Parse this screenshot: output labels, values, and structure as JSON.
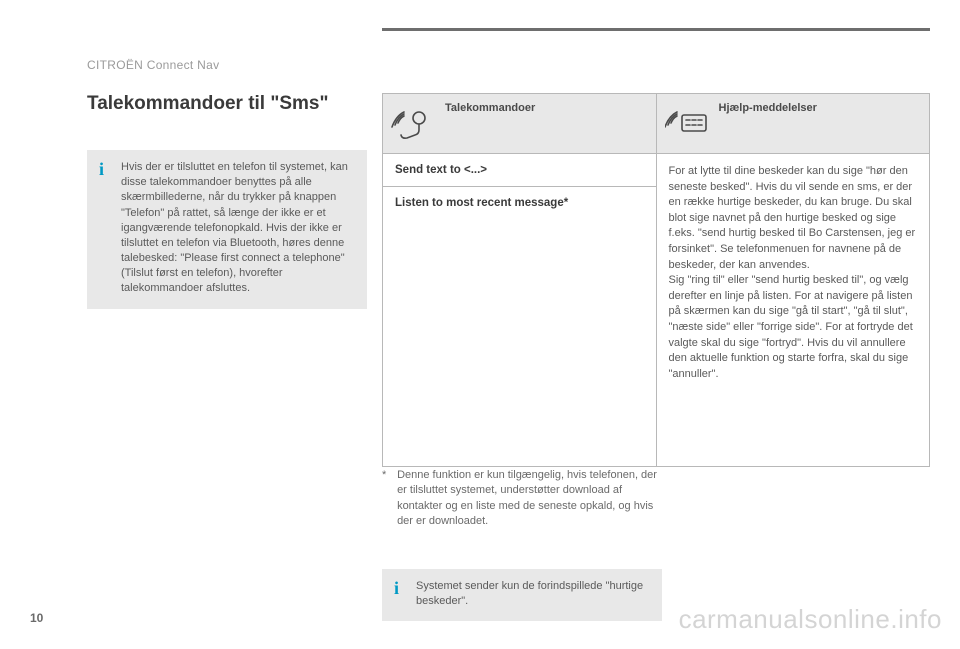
{
  "header": {
    "section": "CITROËN Connect Nav"
  },
  "page": {
    "number": "10",
    "title": "Talekommandoer til \"Sms\""
  },
  "info1": {
    "text": "Hvis der er tilsluttet en telefon til systemet, kan disse talekommandoer benyttes på alle skærmbillederne, når du trykker på knappen \"Telefon\" på rattet, så længe der ikke er et igangværende telefonopkald. Hvis der ikke er tilsluttet en telefon via Bluetooth, høres denne talebesked: \"Please first connect a telephone\" (Tilslut først en telefon), hvorefter talekommandoer afsluttes."
  },
  "table": {
    "col1_header": "Talekommandoer",
    "col2_header": "Hjælp-meddelelser",
    "row1_cmd": "Send text to <...>",
    "row2_cmd": "Listen to most recent message*",
    "help_text": "For at lytte til dine beskeder kan du sige \"hør den seneste besked\". Hvis du vil sende en sms, er der en række hurtige beskeder, du kan bruge. Du skal blot sige navnet på den hurtige besked og sige f.eks. \"send hurtig besked til Bo Carstensen, jeg er forsinket\". Se telefonmenuen for navnene på de beskeder, der kan anvendes.\nSig \"ring til\" eller \"send hurtig besked til\", og vælg derefter en linje på listen. For at navigere på listen på skærmen kan du sige \"gå til start\", \"gå til slut\", \"næste side\" eller \"forrige side\". For at fortryde det valgte skal du sige \"fortryd\". Hvis du vil annullere den aktuelle funktion og starte forfra, skal du sige \"annuller\"."
  },
  "footnote": {
    "marker": "*",
    "text": "Denne funktion er kun tilgængelig, hvis telefonen, der er tilsluttet systemet, understøtter download af kontakter og en liste med de seneste opkald, og hvis der er downloadet."
  },
  "info2": {
    "text": "Systemet sender kun de forindspillede \"hurtige beskeder\"."
  },
  "watermark": "carmanualsonline.info"
}
